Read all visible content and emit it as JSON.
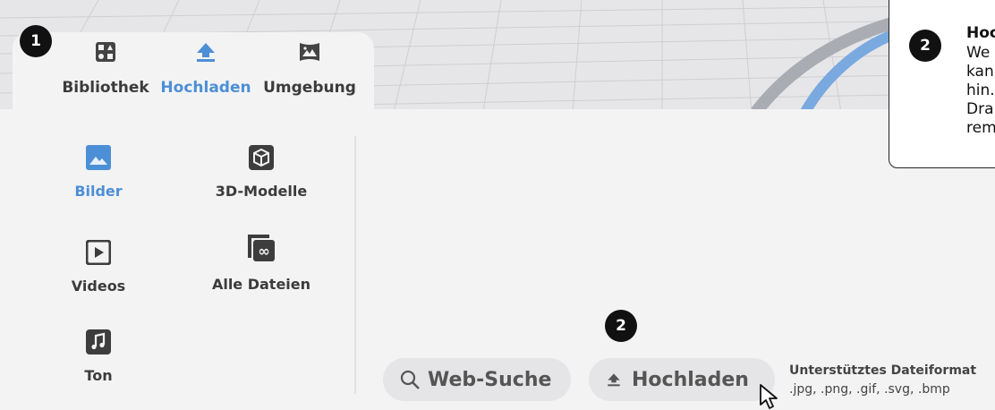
{
  "tabs": [
    {
      "label": "Bibliothek",
      "icon": "library-icon",
      "active": false
    },
    {
      "label": "Hochladen",
      "icon": "upload-icon",
      "active": true
    },
    {
      "label": "Umgebung",
      "icon": "environment-icon",
      "active": false
    }
  ],
  "categories": [
    {
      "label": "Bilder",
      "icon": "image-icon",
      "active": true
    },
    {
      "label": "3D-Modelle",
      "icon": "cube-icon",
      "active": false
    },
    {
      "label": "Videos",
      "icon": "video-icon",
      "active": false
    },
    {
      "label": "Alle Dateien",
      "icon": "all-files-icon",
      "active": false
    },
    {
      "label": "Ton",
      "icon": "music-note-icon",
      "active": false
    }
  ],
  "actions": {
    "web_search_label": "Web-Suche",
    "upload_label": "Hochladen"
  },
  "formats": {
    "title": "Unterstütztes Dateiformat",
    "list": ".jpg, .png, .gif, .svg, .bmp"
  },
  "badges": {
    "tabs_step": "1",
    "upload_step": "2",
    "callout_step": "2"
  },
  "callout": {
    "title": "Hoc",
    "lines": [
      "We",
      "kan",
      "hin.",
      "Dra",
      "rem"
    ]
  },
  "colors": {
    "accent": "#4d8fd6",
    "text": "#3b3b3b",
    "badge": "#111111",
    "pill": "#e5e5e7"
  }
}
